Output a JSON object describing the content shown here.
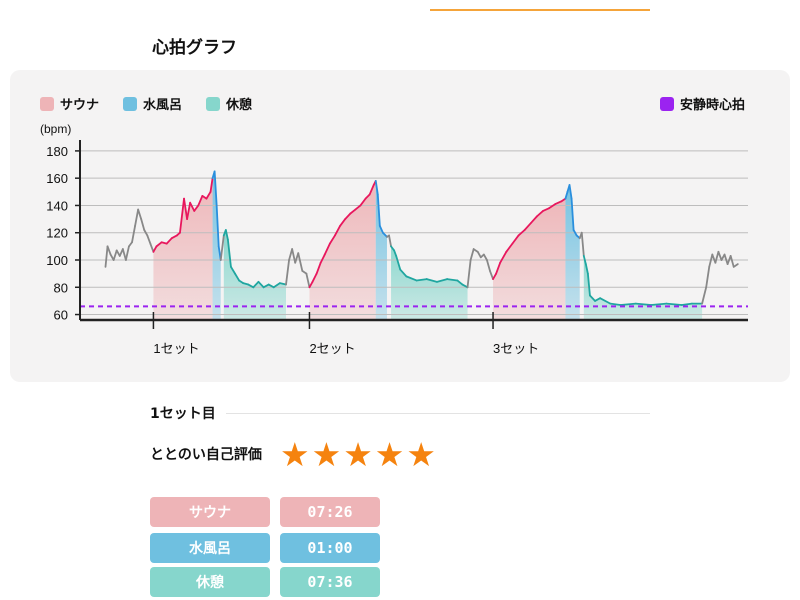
{
  "page": {
    "title": "心拍グラフ"
  },
  "colors": {
    "sauna": "#eeb4b7",
    "water": "#6fc0e0",
    "rest": "#86d6cc",
    "resting": "#9b23f0",
    "line_normal": "#888888",
    "line_sauna": "#e8175d",
    "line_water": "#2a8fdd",
    "line_rest": "#20a6a0",
    "star": "#f5830f"
  },
  "legend": {
    "sauna": "サウナ",
    "water": "水風呂",
    "rest": "休憩",
    "resting_hr": "安静時心拍"
  },
  "chart_data": {
    "type": "line",
    "ylabel": "(bpm)",
    "yticks": [
      60,
      80,
      100,
      120,
      140,
      160,
      180
    ],
    "ylim": [
      56,
      188
    ],
    "xlim": [
      0,
      655
    ],
    "resting_hr": 66,
    "set_labels": [
      {
        "label": "1セット",
        "x": 72
      },
      {
        "label": "2セット",
        "x": 225
      },
      {
        "label": "3セット",
        "x": 405
      }
    ],
    "phases": [
      {
        "type": "sauna",
        "x0": 72,
        "x1": 130
      },
      {
        "type": "water",
        "x0": 130,
        "x1": 138
      },
      {
        "type": "rest",
        "x0": 141,
        "x1": 202
      },
      {
        "type": "sauna",
        "x0": 225,
        "x1": 290
      },
      {
        "type": "water",
        "x0": 290,
        "x1": 301
      },
      {
        "type": "rest",
        "x0": 305,
        "x1": 380
      },
      {
        "type": "sauna",
        "x0": 405,
        "x1": 476
      },
      {
        "type": "water",
        "x0": 476,
        "x1": 490
      },
      {
        "type": "rest",
        "x0": 494,
        "x1": 610
      }
    ],
    "points": [
      [
        25,
        95
      ],
      [
        27,
        110
      ],
      [
        30,
        104
      ],
      [
        33,
        100
      ],
      [
        36,
        107
      ],
      [
        39,
        103
      ],
      [
        42,
        108
      ],
      [
        45,
        100
      ],
      [
        48,
        110
      ],
      [
        51,
        113
      ],
      [
        54,
        125
      ],
      [
        57,
        137
      ],
      [
        60,
        130
      ],
      [
        63,
        122
      ],
      [
        66,
        118
      ],
      [
        69,
        112
      ],
      [
        72,
        106
      ],
      [
        75,
        110
      ],
      [
        80,
        113
      ],
      [
        85,
        112
      ],
      [
        90,
        116
      ],
      [
        95,
        118
      ],
      [
        98,
        120
      ],
      [
        102,
        145
      ],
      [
        105,
        130
      ],
      [
        108,
        142
      ],
      [
        112,
        136
      ],
      [
        116,
        140
      ],
      [
        120,
        147
      ],
      [
        124,
        145
      ],
      [
        128,
        150
      ],
      [
        130,
        160
      ],
      [
        132,
        165
      ],
      [
        134,
        140
      ],
      [
        136,
        110
      ],
      [
        138,
        100
      ],
      [
        141,
        118
      ],
      [
        143,
        122
      ],
      [
        145,
        115
      ],
      [
        148,
        95
      ],
      [
        152,
        90
      ],
      [
        156,
        85
      ],
      [
        160,
        83
      ],
      [
        165,
        82
      ],
      [
        170,
        80
      ],
      [
        175,
        84
      ],
      [
        180,
        80
      ],
      [
        185,
        82
      ],
      [
        190,
        80
      ],
      [
        196,
        83
      ],
      [
        202,
        82
      ],
      [
        205,
        100
      ],
      [
        208,
        108
      ],
      [
        211,
        98
      ],
      [
        214,
        105
      ],
      [
        218,
        92
      ],
      [
        222,
        90
      ],
      [
        225,
        80
      ],
      [
        228,
        84
      ],
      [
        232,
        90
      ],
      [
        236,
        98
      ],
      [
        240,
        104
      ],
      [
        245,
        112
      ],
      [
        250,
        118
      ],
      [
        255,
        125
      ],
      [
        260,
        130
      ],
      [
        265,
        134
      ],
      [
        270,
        137
      ],
      [
        275,
        140
      ],
      [
        280,
        145
      ],
      [
        284,
        148
      ],
      [
        288,
        155
      ],
      [
        290,
        158
      ],
      [
        292,
        148
      ],
      [
        294,
        125
      ],
      [
        297,
        120
      ],
      [
        301,
        117
      ],
      [
        303,
        118
      ],
      [
        305,
        110
      ],
      [
        308,
        107
      ],
      [
        310,
        103
      ],
      [
        314,
        93
      ],
      [
        320,
        88
      ],
      [
        330,
        85
      ],
      [
        340,
        86
      ],
      [
        350,
        84
      ],
      [
        360,
        86
      ],
      [
        370,
        85
      ],
      [
        375,
        82
      ],
      [
        380,
        80
      ],
      [
        383,
        100
      ],
      [
        386,
        108
      ],
      [
        390,
        106
      ],
      [
        393,
        102
      ],
      [
        396,
        104
      ],
      [
        399,
        100
      ],
      [
        402,
        92
      ],
      [
        405,
        86
      ],
      [
        408,
        90
      ],
      [
        412,
        98
      ],
      [
        418,
        106
      ],
      [
        424,
        112
      ],
      [
        430,
        118
      ],
      [
        436,
        122
      ],
      [
        442,
        127
      ],
      [
        448,
        132
      ],
      [
        454,
        136
      ],
      [
        460,
        138
      ],
      [
        466,
        141
      ],
      [
        472,
        143
      ],
      [
        476,
        145
      ],
      [
        478,
        150
      ],
      [
        480,
        155
      ],
      [
        482,
        145
      ],
      [
        484,
        122
      ],
      [
        487,
        118
      ],
      [
        490,
        116
      ],
      [
        492,
        120
      ],
      [
        494,
        103
      ],
      [
        496,
        97
      ],
      [
        498,
        90
      ],
      [
        500,
        74
      ],
      [
        505,
        70
      ],
      [
        510,
        72
      ],
      [
        520,
        68
      ],
      [
        530,
        67
      ],
      [
        545,
        68
      ],
      [
        560,
        67
      ],
      [
        575,
        68
      ],
      [
        590,
        67
      ],
      [
        600,
        68
      ],
      [
        610,
        68
      ],
      [
        614,
        80
      ],
      [
        617,
        95
      ],
      [
        620,
        104
      ],
      [
        623,
        98
      ],
      [
        626,
        106
      ],
      [
        629,
        100
      ],
      [
        632,
        104
      ],
      [
        635,
        97
      ],
      [
        638,
        103
      ],
      [
        641,
        95
      ],
      [
        645,
        97
      ]
    ]
  },
  "set1": {
    "header": "1セット目",
    "rating_label": "ととのい自己評価",
    "stars": 5,
    "rows": [
      {
        "name": "サウナ",
        "time": "07:26"
      },
      {
        "name": "水風呂",
        "time": "01:00"
      },
      {
        "name": "休憩",
        "time": "07:36"
      }
    ]
  }
}
